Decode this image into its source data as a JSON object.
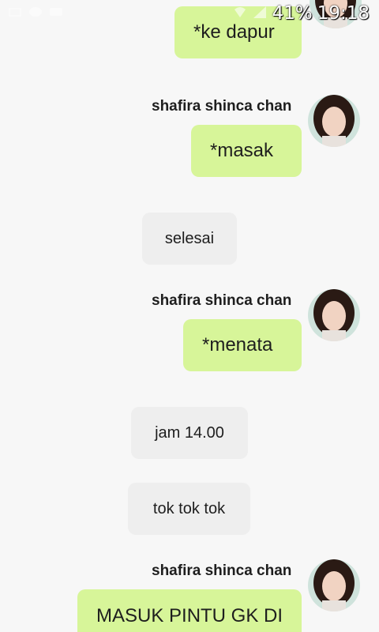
{
  "status_bar": {
    "battery": "41%",
    "time": "19:18"
  },
  "sender_name": "shafira shinca chan",
  "messages": [
    {
      "text": "*ke dapur"
    },
    {
      "text": "*masak"
    },
    {
      "text": "selesai"
    },
    {
      "text": "*menata"
    },
    {
      "text": "jam 14.00"
    },
    {
      "text": "tok tok tok"
    },
    {
      "text": "MASUK PINTU GK DI"
    }
  ]
}
